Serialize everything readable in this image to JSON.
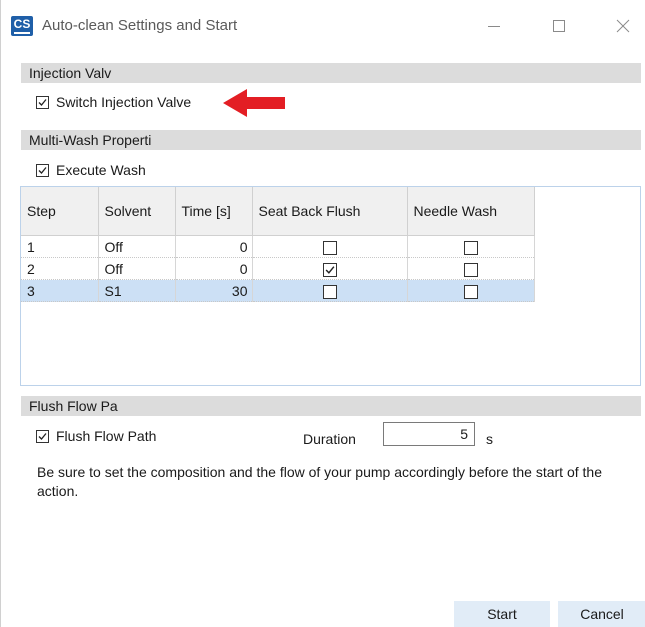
{
  "window": {
    "title": "Auto-clean Settings and Start",
    "icon": "CS",
    "controls": [
      "minimize-icon",
      "maximize-icon",
      "close-icon"
    ]
  },
  "injection": {
    "header": "Injection Valv",
    "switch_valve_label": "Switch Injection Valve",
    "switch_valve_checked": true
  },
  "multiwash": {
    "header": "Multi-Wash Properti",
    "execute_wash_label": "Execute Wash",
    "execute_wash_checked": true,
    "columns": [
      "Step",
      "Solvent",
      "Time [s]",
      "Seat Back Flush",
      "Needle Wash"
    ],
    "rows": [
      {
        "step": "1",
        "solvent": "Off",
        "time": "0",
        "seat_back_flush": false,
        "needle_wash": false,
        "selected": false
      },
      {
        "step": "2",
        "solvent": "Off",
        "time": "0",
        "seat_back_flush": true,
        "needle_wash": false,
        "selected": false
      },
      {
        "step": "3",
        "solvent": "S1",
        "time": "30",
        "seat_back_flush": false,
        "needle_wash": false,
        "selected": true
      }
    ]
  },
  "flush": {
    "header": "Flush Flow Pa",
    "flush_path_label": "Flush Flow Path",
    "flush_path_checked": true,
    "duration_label": "Duration",
    "duration_value": "5",
    "duration_unit": "s"
  },
  "note": "Be sure to set the composition and the flow of your pump accordingly before the start of the action.",
  "buttons": {
    "start": "Start",
    "cancel": "Cancel"
  },
  "colors": {
    "arrow": "#e31e24",
    "selected_row": "#cce0f5",
    "section_header": "#dcdcdc",
    "button_bg": "#e1ecf7"
  }
}
